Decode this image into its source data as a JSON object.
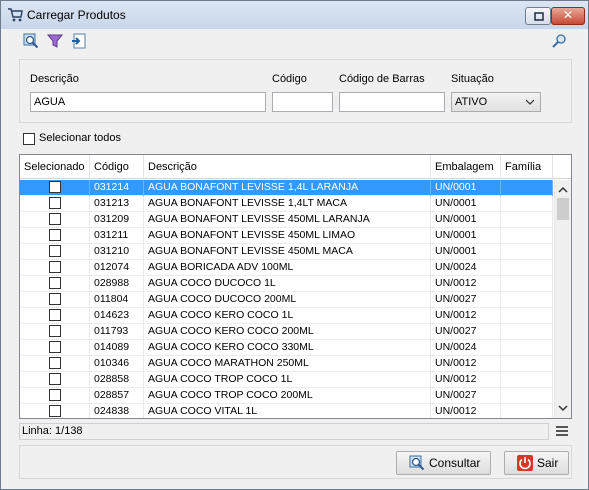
{
  "window": {
    "title": "Carregar Produtos"
  },
  "filters": {
    "descricao_label": "Descrição",
    "descricao_value": "AGUA",
    "codigo_label": "Código",
    "codigo_value": "",
    "codigo_barras_label": "Código de Barras",
    "codigo_barras_value": "",
    "situacao_label": "Situação",
    "situacao_value": "ATIVO"
  },
  "select_all_label": "Selecionar todos",
  "grid": {
    "headers": [
      "Selecionado",
      "Código",
      "Descrição",
      "Embalagem",
      "Família"
    ],
    "rows": [
      {
        "codigo": "031214",
        "descricao": "AGUA BONAFONT LEVISSE 1,4L LARANJA",
        "embalagem": "UN/0001",
        "familia": ""
      },
      {
        "codigo": "031213",
        "descricao": "AGUA BONAFONT LEVISSE 1,4LT MACA",
        "embalagem": "UN/0001",
        "familia": ""
      },
      {
        "codigo": "031209",
        "descricao": "AGUA BONAFONT LEVISSE 450ML LARANJA",
        "embalagem": "UN/0001",
        "familia": ""
      },
      {
        "codigo": "031211",
        "descricao": "AGUA BONAFONT LEVISSE 450ML LIMAO",
        "embalagem": "UN/0001",
        "familia": ""
      },
      {
        "codigo": "031210",
        "descricao": "AGUA BONAFONT LEVISSE 450ML MACA",
        "embalagem": "UN/0001",
        "familia": ""
      },
      {
        "codigo": "012074",
        "descricao": "AGUA BORICADA ADV 100ML",
        "embalagem": "UN/0024",
        "familia": ""
      },
      {
        "codigo": "028988",
        "descricao": "AGUA COCO DUCOCO 1L",
        "embalagem": "UN/0012",
        "familia": ""
      },
      {
        "codigo": "011804",
        "descricao": "AGUA COCO DUCOCO 200ML",
        "embalagem": "UN/0027",
        "familia": ""
      },
      {
        "codigo": "014623",
        "descricao": "AGUA COCO KERO COCO 1L",
        "embalagem": "UN/0012",
        "familia": ""
      },
      {
        "codigo": "011793",
        "descricao": "AGUA COCO KERO COCO 200ML",
        "embalagem": "UN/0027",
        "familia": ""
      },
      {
        "codigo": "014089",
        "descricao": "AGUA COCO KERO COCO 330ML",
        "embalagem": "UN/0024",
        "familia": ""
      },
      {
        "codigo": "010346",
        "descricao": "AGUA COCO MARATHON 250ML",
        "embalagem": "UN/0012",
        "familia": ""
      },
      {
        "codigo": "028858",
        "descricao": "AGUA COCO TROP COCO 1L",
        "embalagem": "UN/0012",
        "familia": ""
      },
      {
        "codigo": "028857",
        "descricao": "AGUA COCO TROP COCO 200ML",
        "embalagem": "UN/0027",
        "familia": ""
      },
      {
        "codigo": "024838",
        "descricao": "AGUA COCO VITAL 1L",
        "embalagem": "UN/0012",
        "familia": ""
      }
    ]
  },
  "status_text": "Linha: 1/138",
  "buttons": {
    "consultar": "Consultar",
    "sair": "Sair"
  },
  "icons": {
    "title": "cart-icon",
    "toolbar": [
      "search-zoom-icon",
      "filter-icon",
      "export-icon"
    ],
    "toolbar_right": "key-search-icon"
  },
  "colors": {
    "selection": "#3399ff",
    "title_bar": "#c7d6ea"
  }
}
